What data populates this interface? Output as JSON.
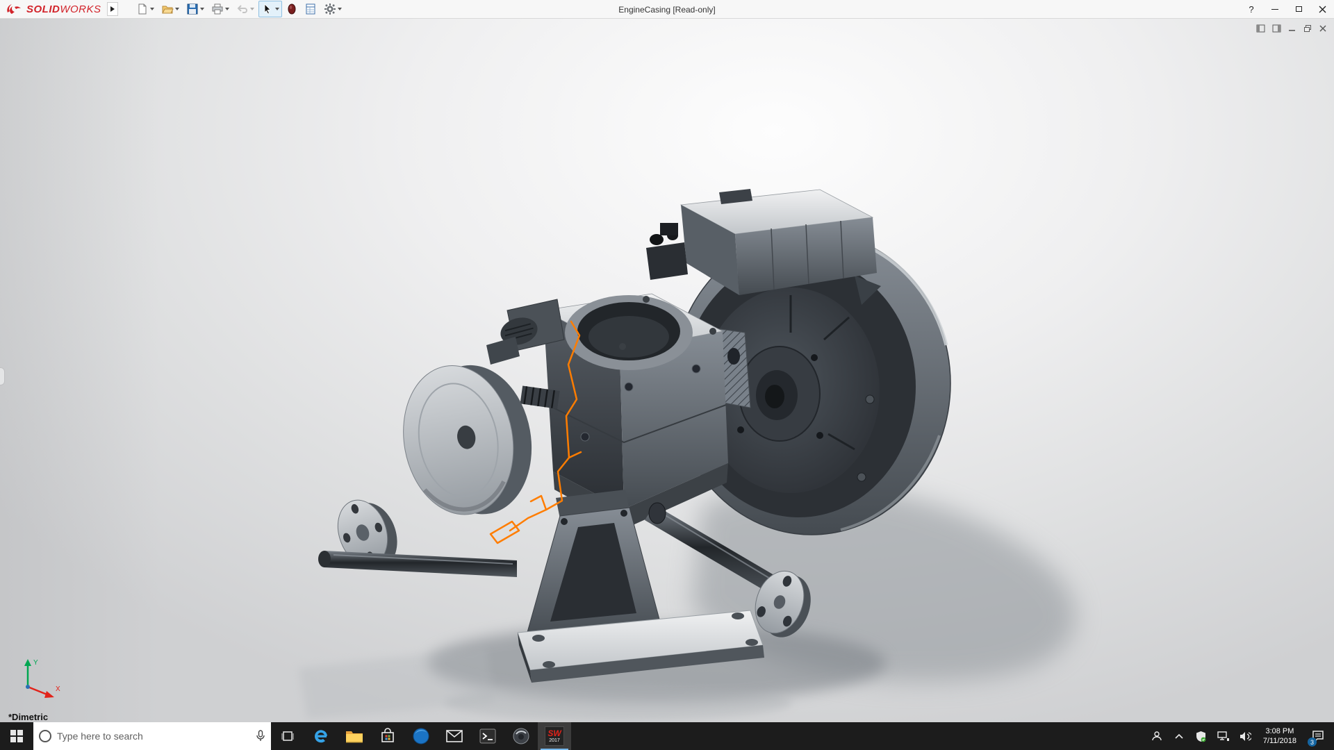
{
  "colors": {
    "brand_red": "#d2232a",
    "sketch_orange": "#ff7d00",
    "taskbar_bg": "#1c1c1c",
    "active_app_underline": "#76b9ed",
    "model_dark": "#2e3237",
    "model_light": "#c7cbd0"
  },
  "titlebar": {
    "brand_solid": "SOLID",
    "brand_works": "WORKS",
    "doc_title": "EngineCasing [Read-only]",
    "help_label": "?"
  },
  "viewport": {
    "view_orientation_label": "*Dimetric",
    "triad_x_label": "X",
    "triad_y_label": "Y"
  },
  "taskbar": {
    "search_placeholder": "Type here to search",
    "sw_badge_line1": "SW",
    "sw_badge_line2": "2017",
    "clock_time": "3:08 PM",
    "clock_date": "7/11/2018",
    "action_center_badge": "3"
  }
}
